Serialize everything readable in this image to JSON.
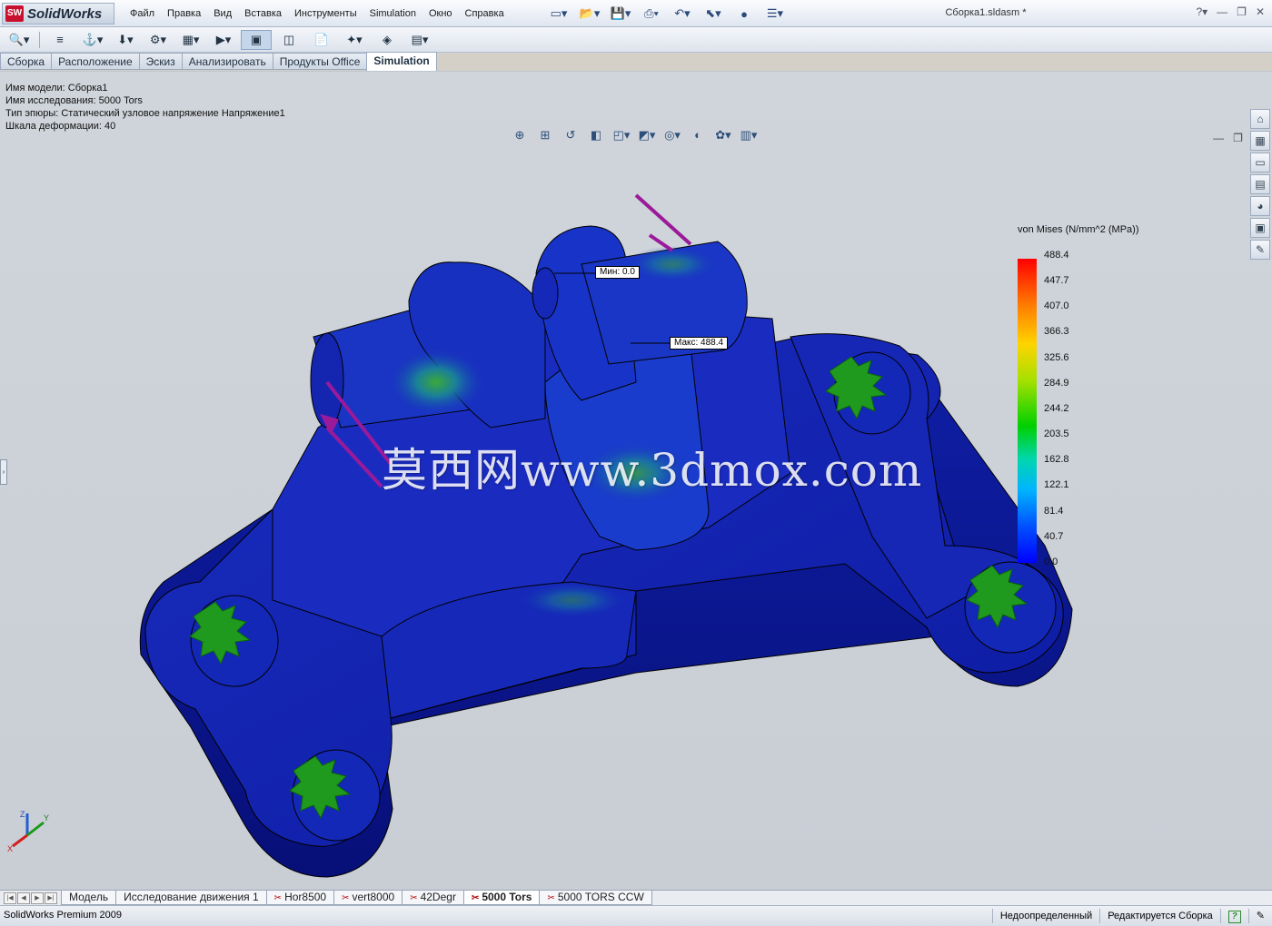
{
  "app": {
    "logo_text": "SolidWorks",
    "document_title": "Сборка1.sldasm *"
  },
  "menu": [
    "Файл",
    "Правка",
    "Вид",
    "Вставка",
    "Инструменты",
    "Simulation",
    "Окно",
    "Справка"
  ],
  "command_tabs": [
    {
      "label": "Сборка",
      "active": false
    },
    {
      "label": "Расположение",
      "active": false
    },
    {
      "label": "Эскиз",
      "active": false
    },
    {
      "label": "Анализировать",
      "active": false
    },
    {
      "label": "Продукты Office",
      "active": false
    },
    {
      "label": "Simulation",
      "active": true
    }
  ],
  "study_info": {
    "model_name": "Имя модели: Сборка1",
    "study_name": "Имя  исследования: 5000 Tors",
    "plot_type": "Тип эпюры: Статический узловое напряжение Напряжение1",
    "deform_scale": "Шкала деформации: 40"
  },
  "legend": {
    "title": "von Mises (N/mm^2 (MPa))",
    "labels": [
      "488.4",
      "447.7",
      "407.0",
      "366.3",
      "325.6",
      "284.9",
      "244.2",
      "203.5",
      "162.8",
      "122.1",
      "81.4",
      "40.7",
      "0.0"
    ],
    "max_color": "#ff0000",
    "min_color": "#0000ff"
  },
  "probes": {
    "min": "Мин: 0.0",
    "max": "Макс: 488.4"
  },
  "watermark": "莫西网www.3dmox.com",
  "bottom_tabs": [
    {
      "label": "Модель",
      "active": false,
      "icon": false
    },
    {
      "label": "Исследование движения 1",
      "active": false,
      "icon": false
    },
    {
      "label": "Hor8500",
      "active": false,
      "icon": true
    },
    {
      "label": "vert8000",
      "active": false,
      "icon": true
    },
    {
      "label": "42Degr",
      "active": false,
      "icon": true
    },
    {
      "label": "5000 Tors",
      "active": true,
      "icon": true
    },
    {
      "label": "5000 TORS CCW",
      "active": false,
      "icon": true
    }
  ],
  "status": {
    "product": "SolidWorks Premium 2009",
    "definition": "Недоопределенный",
    "mode": "Редактируется Сборка"
  },
  "triad": {
    "x": "X",
    "y": "Y",
    "z": "Z"
  },
  "colors": {
    "part_blue": "#1020b0",
    "accent": "#c8102e",
    "load_arrow": "#9a1a9a",
    "fixture": "#1f9a1f"
  }
}
